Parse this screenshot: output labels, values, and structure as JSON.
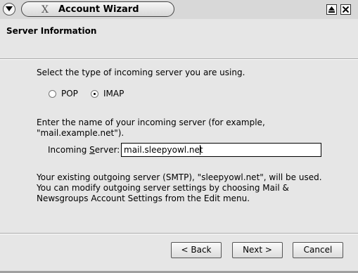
{
  "window": {
    "title": "Account Wizard",
    "logo": "X"
  },
  "header": {
    "title": "Server Information"
  },
  "server_type": {
    "prompt": "Select the type of incoming server you are using.",
    "options": [
      {
        "label": "POP",
        "selected": false
      },
      {
        "label": "IMAP",
        "selected": true
      }
    ]
  },
  "incoming": {
    "prompt_line1": "Enter the name of your incoming server (for example,",
    "prompt_line2": "\"mail.example.net\").",
    "label_prefix": "Incoming ",
    "label_mnemonic": "S",
    "label_suffix": "erver:",
    "value": "mail.sleepyowl.net"
  },
  "outgoing": {
    "line1": "Your existing outgoing server (SMTP), \"sleepyowl.net\", will be used.",
    "line2": "You can modify outgoing server settings by choosing Mail &",
    "line3": "Newsgroups Account Settings from the Edit menu."
  },
  "buttons": {
    "back": "< Back",
    "next": "Next >",
    "cancel": "Cancel"
  },
  "icons": {
    "window_menu": "chevron-down-icon",
    "shade": "shade-icon",
    "close": "close-icon"
  }
}
